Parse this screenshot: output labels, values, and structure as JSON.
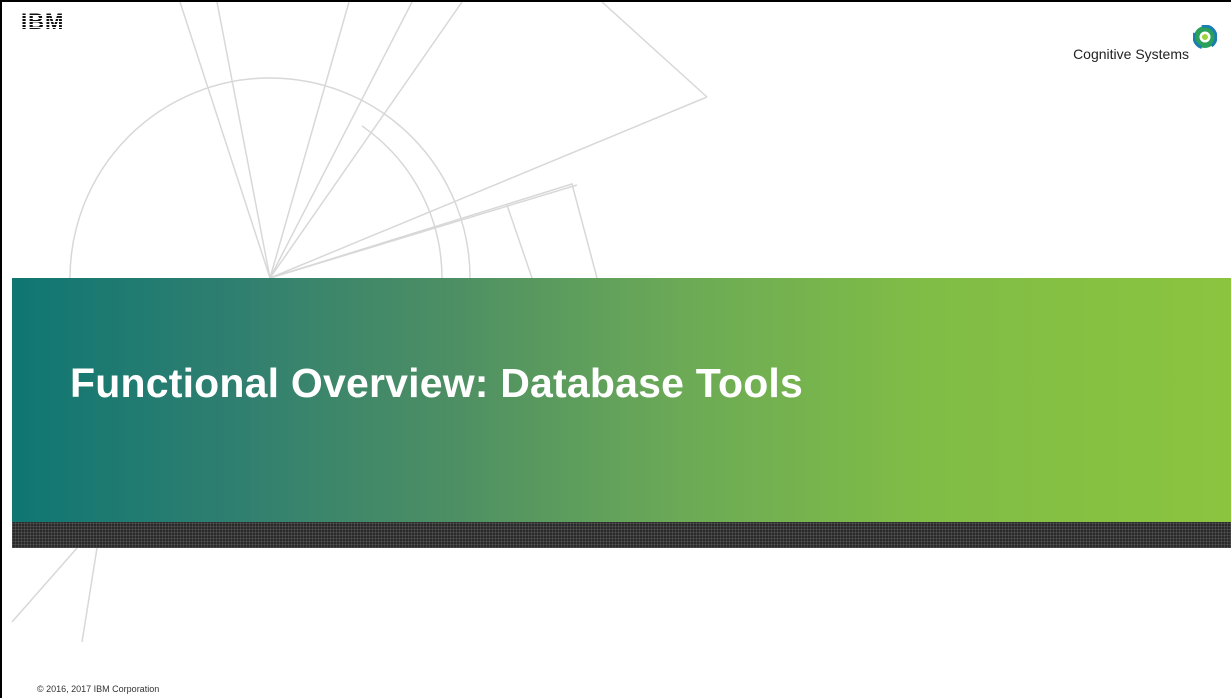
{
  "header": {
    "logo_text": "IBM",
    "brand_label": "Cognitive Systems",
    "brand_icon": "cognitive-systems-ring-icon"
  },
  "title_band": {
    "title": "Functional Overview: Database Tools",
    "gradient_colors": [
      "#0f7672",
      "#4d8f64",
      "#8bc43f"
    ]
  },
  "footer": {
    "copyright": "© 2016, 2017 IBM Corporation"
  }
}
